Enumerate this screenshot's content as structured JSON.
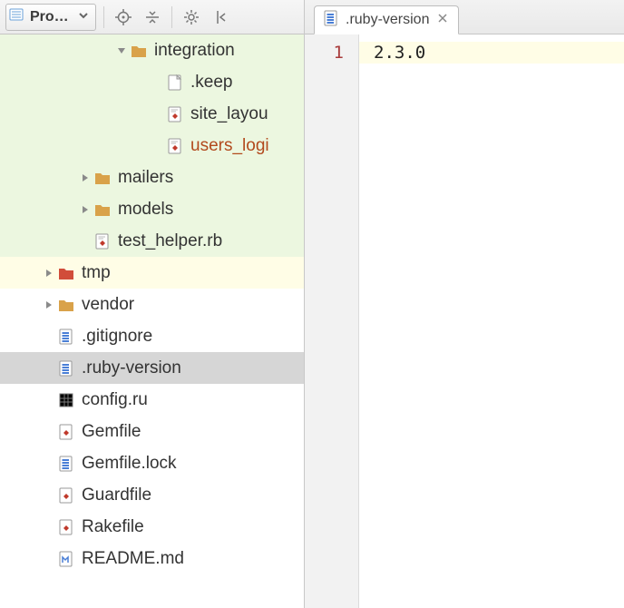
{
  "sidebar": {
    "panel_title": "Project",
    "toolbar_icons": [
      "target-icon",
      "collapse-icon",
      "gear-icon",
      "hide-icon"
    ]
  },
  "tree": [
    {
      "indent": 3,
      "icon": "folder",
      "name": "integration",
      "arrow": "down",
      "row": "tests"
    },
    {
      "indent": 4,
      "icon": "blank-file",
      "name": ".keep",
      "row": "tests"
    },
    {
      "indent": 4,
      "icon": "ruby-file",
      "name": "site_layou",
      "row": "tests"
    },
    {
      "indent": 4,
      "icon": "ruby-file",
      "name": "users_logi",
      "row": "tests",
      "special": true
    },
    {
      "indent": 2,
      "icon": "folder",
      "name": "mailers",
      "arrow": "right",
      "row": "tests"
    },
    {
      "indent": 2,
      "icon": "folder",
      "name": "models",
      "arrow": "right",
      "row": "tests"
    },
    {
      "indent": 2,
      "icon": "ruby-file",
      "name": "test_helper.rb",
      "row": "tests"
    },
    {
      "indent": 1,
      "icon": "folder-red",
      "name": "tmp",
      "arrow": "right",
      "row": "hl"
    },
    {
      "indent": 1,
      "icon": "folder",
      "name": "vendor",
      "arrow": "right"
    },
    {
      "indent": 1,
      "icon": "text-file",
      "name": ".gitignore"
    },
    {
      "indent": 1,
      "icon": "text-file",
      "name": ".ruby-version",
      "selected": true
    },
    {
      "indent": 1,
      "icon": "grid-file",
      "name": "config.ru"
    },
    {
      "indent": 1,
      "icon": "ruby-plain",
      "name": "Gemfile"
    },
    {
      "indent": 1,
      "icon": "text-file",
      "name": "Gemfile.lock"
    },
    {
      "indent": 1,
      "icon": "ruby-plain",
      "name": "Guardfile"
    },
    {
      "indent": 1,
      "icon": "ruby-plain",
      "name": "Rakefile"
    },
    {
      "indent": 1,
      "icon": "md-file",
      "name": "README.md"
    }
  ],
  "editor": {
    "tab_label": ".ruby-version",
    "lines": [
      {
        "n": "1",
        "text": "2.3.0",
        "current": true
      }
    ]
  }
}
